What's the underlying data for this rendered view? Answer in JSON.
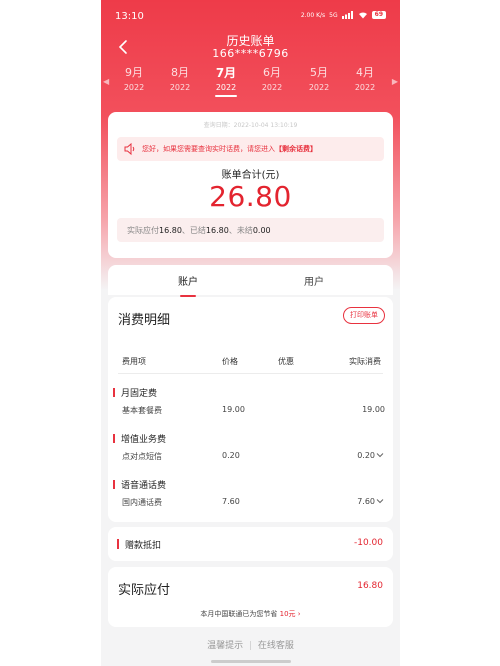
{
  "status_bar": {
    "time": "13:10",
    "net_speed": "2.00 K/s",
    "net_type": "5G",
    "battery": "69"
  },
  "header": {
    "title": "历史账单",
    "phone": "166****6796"
  },
  "months": [
    {
      "month": "9月",
      "year": "2022"
    },
    {
      "month": "8月",
      "year": "2022"
    },
    {
      "month": "7月",
      "year": "2022",
      "active": true
    },
    {
      "month": "6月",
      "year": "2022"
    },
    {
      "month": "5月",
      "year": "2022"
    },
    {
      "month": "4月",
      "year": "2022"
    }
  ],
  "bill": {
    "query_date": "查询日期：2022-10-04 13:10:19",
    "notice_prefix": "您好，如果您需要查询实时话费，请您进入",
    "notice_link": "【剩余话费】",
    "total_label": "账单合计(元)",
    "total_value": "26.80",
    "payable_label": "实际应付",
    "payable_value": "16.80",
    "paid_label": "已结",
    "paid_value": "16.80",
    "unpaid_label": "未结",
    "unpaid_value": "0.00",
    "sep": "、"
  },
  "tabs": {
    "account": "账户",
    "user": "用户"
  },
  "detail": {
    "title": "消费明细",
    "print_button": "打印账单",
    "columns": [
      "费用项",
      "价格",
      "优惠",
      "实际消费"
    ],
    "groups": [
      {
        "name": "月固定费",
        "item": "基本套餐费",
        "price": "19.00",
        "discount": "",
        "actual": "19.00"
      },
      {
        "name": "增值业务费",
        "item": "点对点短信",
        "price": "0.20",
        "discount": "",
        "actual": "0.20"
      },
      {
        "name": "语音通话费",
        "item": "国内通话费",
        "price": "7.60",
        "discount": "",
        "actual": "7.60"
      }
    ]
  },
  "gift": {
    "label": "赠款抵扣",
    "value": "-10.00"
  },
  "actual": {
    "label": "实际应付",
    "value": "16.80",
    "save_prefix": "本月中国联通已为您节省",
    "save_amount": "10元",
    "save_arrow": "›"
  },
  "footer": {
    "tips": "温馨提示",
    "divider": "|",
    "service": "在线客服"
  },
  "colors": {
    "brand_red": "#e8323f",
    "value_red": "#e3242f"
  }
}
